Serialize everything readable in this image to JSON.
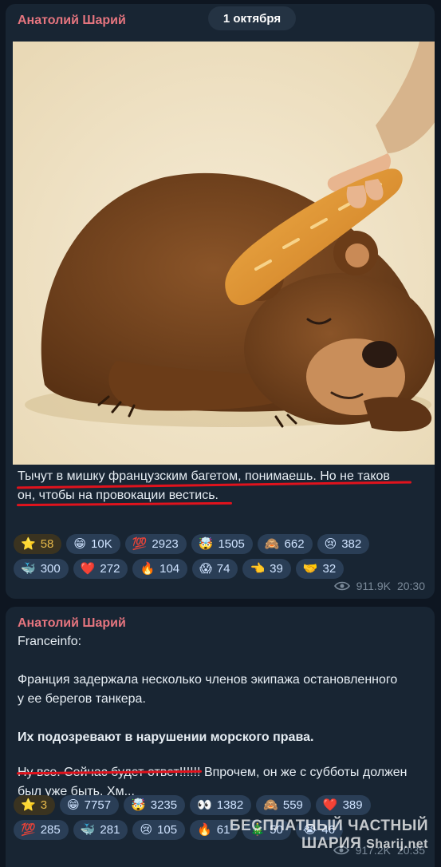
{
  "date_pill": "1 октября",
  "messages": [
    {
      "author": "Анатолий Шарий",
      "text_lines": [
        "Тычут в мишку французским багетом, понимаешь. Но не таков",
        "он, чтобы на провокации вестись."
      ],
      "reactions": [
        [
          {
            "icon": "star-icon",
            "glyph": "⭐",
            "count": "58",
            "star": true
          },
          {
            "icon": "grinning-face-icon",
            "glyph": "😁",
            "count": "10K"
          },
          {
            "icon": "hundred-points-icon",
            "glyph": "💯",
            "count": "2923"
          },
          {
            "icon": "exploding-head-icon",
            "glyph": "🤯",
            "count": "1505"
          },
          {
            "icon": "see-no-evil-monkey-icon",
            "glyph": "🙈",
            "count": "662"
          },
          {
            "icon": "crying-face-icon",
            "glyph": "😢",
            "count": "382"
          }
        ],
        [
          {
            "icon": "whale-icon",
            "glyph": "🐳",
            "count": "300"
          },
          {
            "icon": "red-heart-icon",
            "glyph": "❤️",
            "count": "272"
          },
          {
            "icon": "fire-icon",
            "glyph": "🔥",
            "count": "104"
          },
          {
            "icon": "screaming-face-icon",
            "glyph": "😱",
            "count": "74"
          },
          {
            "icon": "pointing-hand-icon",
            "glyph": "👈",
            "count": "39"
          },
          {
            "icon": "handshake-icon",
            "glyph": "🤝",
            "count": "32"
          }
        ]
      ],
      "views": "911.9K",
      "time": "20:30"
    },
    {
      "author": "Анатолий Шарий",
      "source": "Franceinfo:",
      "paragraph": [
        "Франция задержала несколько членов экипажа остановленного",
        "у ее берегов танкера."
      ],
      "bold_line": "Их подозревают в нарушении морского права.",
      "last_line_1_underlined": "Ну все. Сейчас будет ответ!!!!!!",
      "last_line_1_rest": " Впрочем, он же с субботы должен",
      "last_line_2": "был уже быть. Хм...",
      "reactions": [
        [
          {
            "icon": "star-icon",
            "glyph": "⭐",
            "count": "3",
            "star": true
          },
          {
            "icon": "grinning-face-icon",
            "glyph": "😁",
            "count": "7757"
          },
          {
            "icon": "exploding-head-icon",
            "glyph": "🤯",
            "count": "3235"
          },
          {
            "icon": "eyes-icon",
            "glyph": "👀",
            "count": "1382"
          },
          {
            "icon": "see-no-evil-monkey-icon",
            "glyph": "🙈",
            "count": "559"
          },
          {
            "icon": "red-heart-icon",
            "glyph": "❤️",
            "count": "389"
          }
        ],
        [
          {
            "icon": "hundred-points-icon",
            "glyph": "💯",
            "count": "285"
          },
          {
            "icon": "whale-icon",
            "glyph": "🐳",
            "count": "281"
          },
          {
            "icon": "crying-face-icon",
            "glyph": "😢",
            "count": "105"
          },
          {
            "icon": "fire-icon",
            "glyph": "🔥",
            "count": "61"
          },
          {
            "icon": "christmas-tree-icon",
            "glyph": "🎄",
            "count": "50"
          },
          {
            "icon": "crying-loudly-icon",
            "glyph": "😭",
            "count": "46"
          }
        ]
      ],
      "views": "917.2K",
      "time": "20:35"
    }
  ],
  "watermark": {
    "line1": "БЕСПЛАТНЫЙ ЧАСТНЫЙ",
    "line2": "ШАРИЯ",
    "site": "Sharij.net"
  },
  "colors": {
    "background": "#0e1621",
    "bubble": "#182533",
    "author": "#e6757f",
    "underline": "#e0131d",
    "chip": "#2a3e56"
  }
}
